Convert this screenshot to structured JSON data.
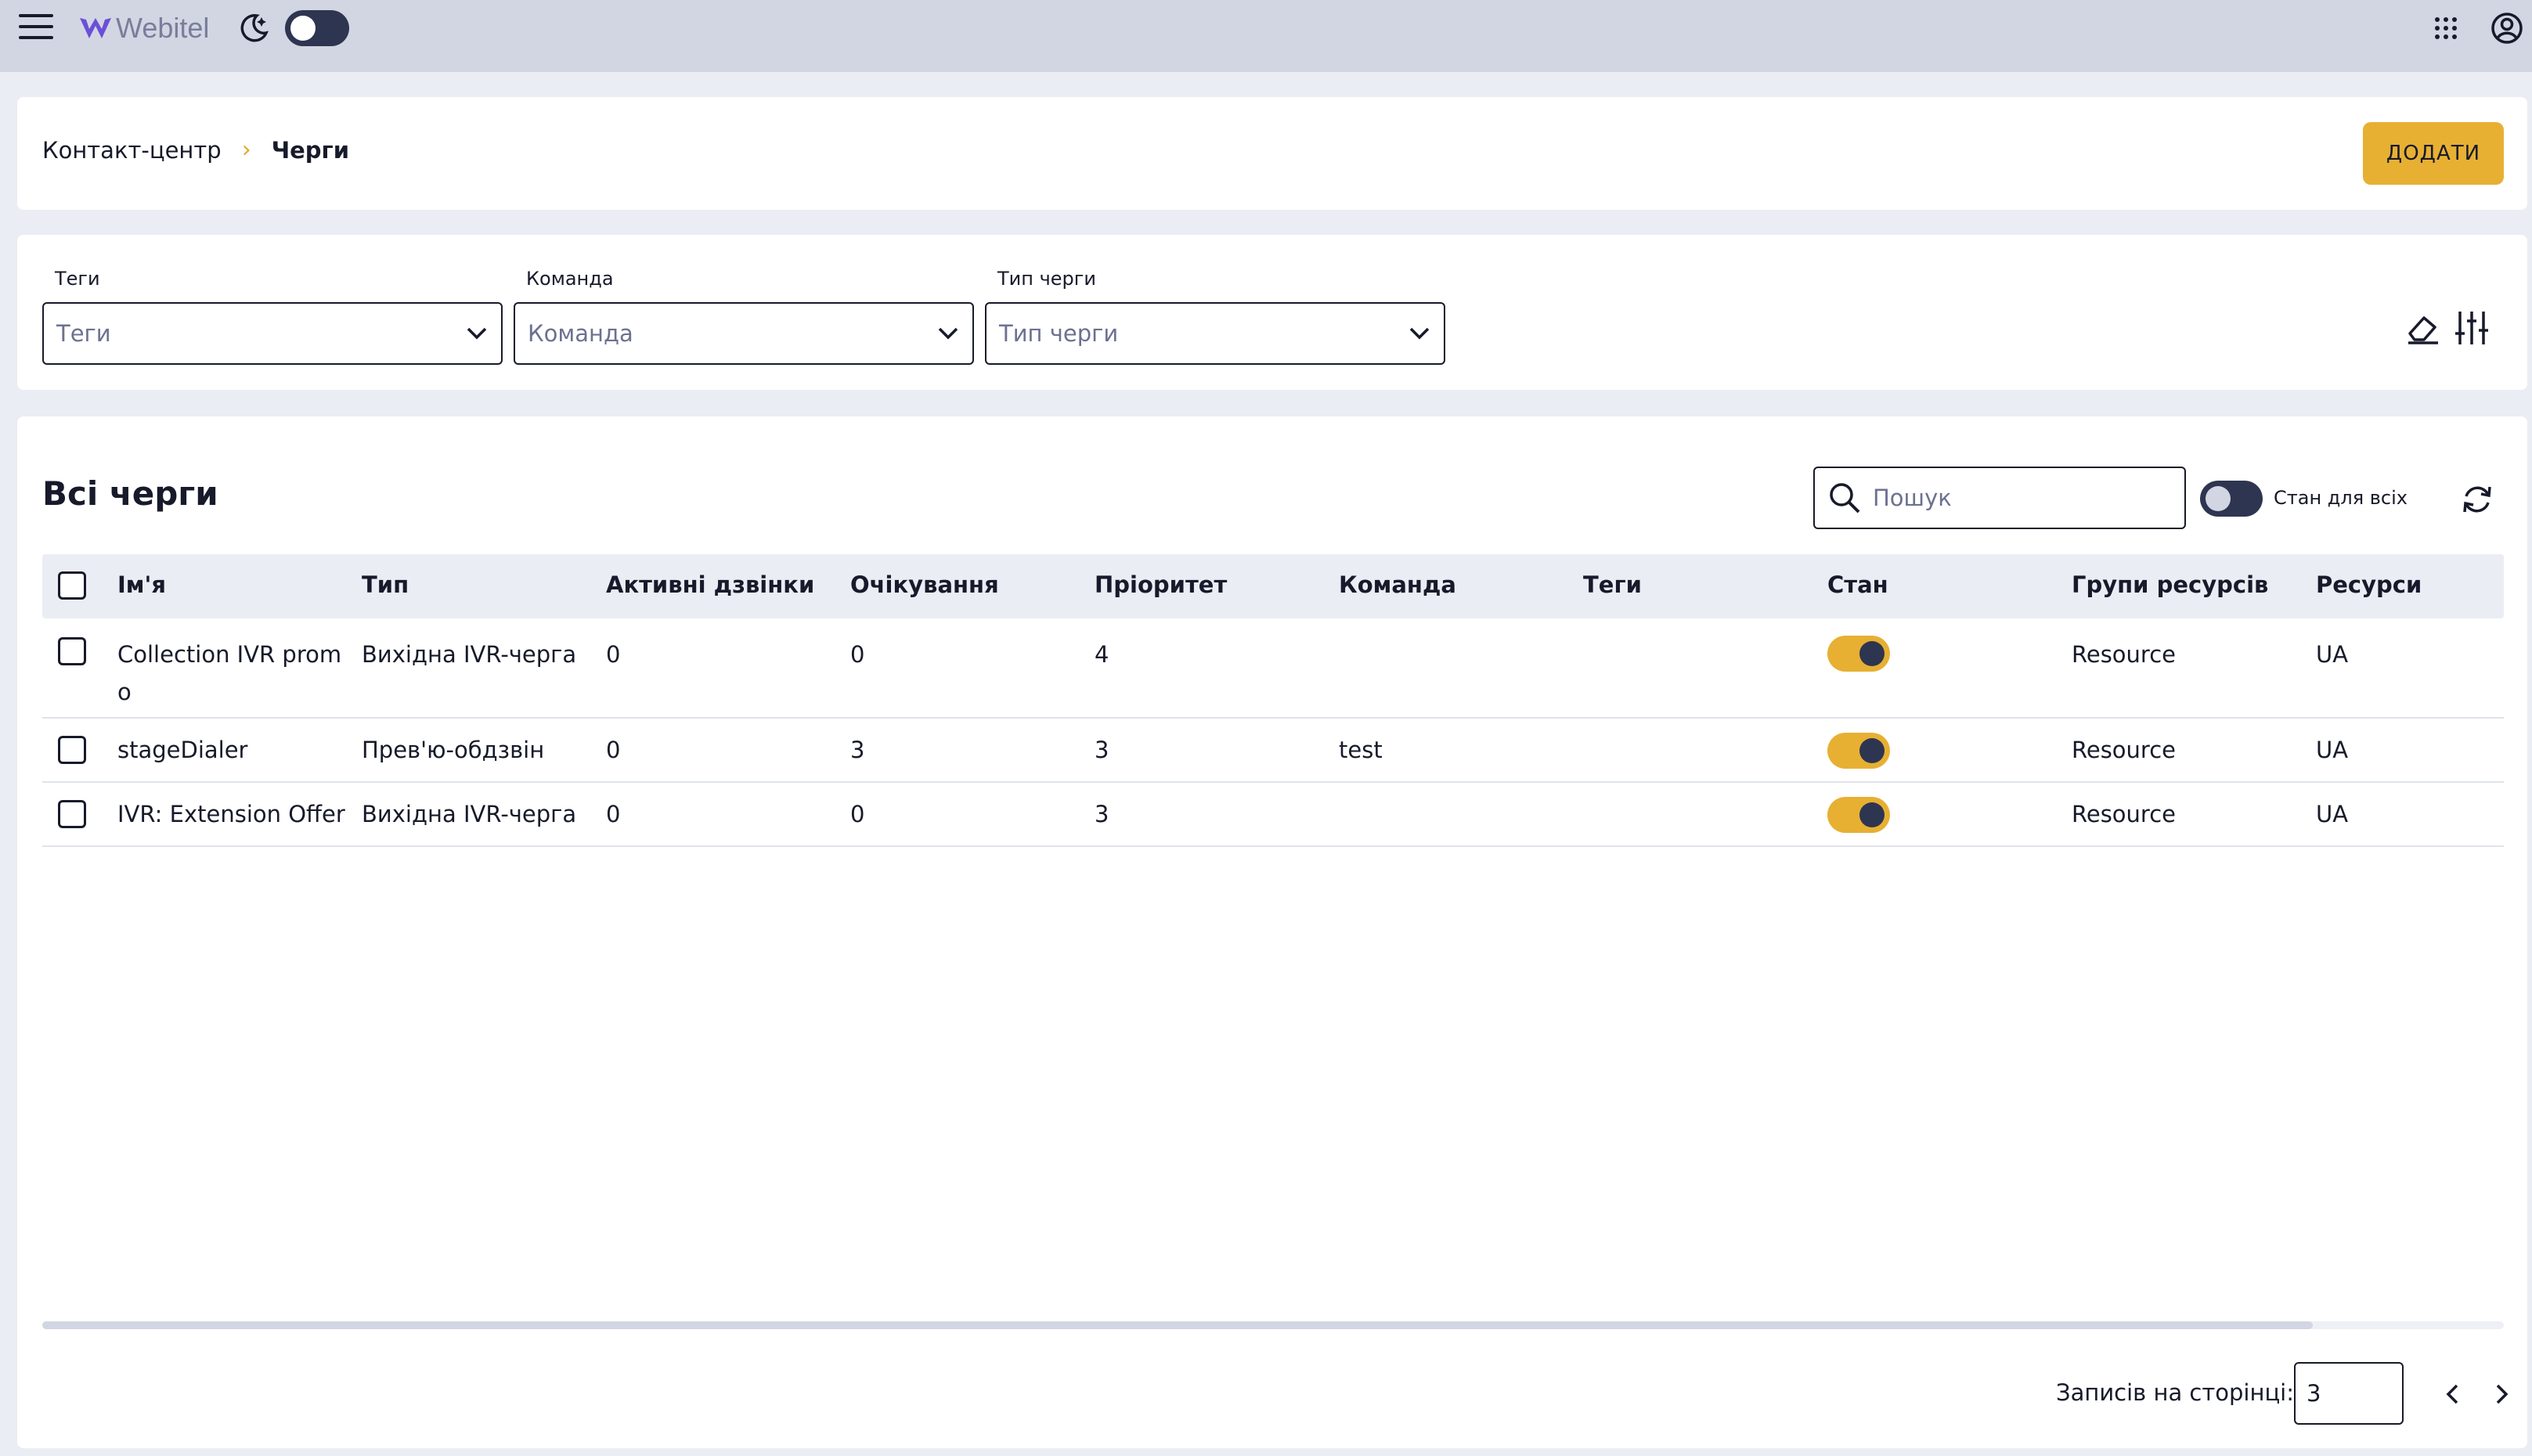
{
  "header": {
    "brand": "Webitel",
    "icons": [
      "menu-icon",
      "webitel-logo",
      "moon-icon",
      "apps-grid-icon",
      "account-icon"
    ]
  },
  "breadcrumb": {
    "parent": "Контакт-центр",
    "separator": "›",
    "current": "Черги"
  },
  "actions": {
    "add_label": "ДОДАТИ"
  },
  "filters": [
    {
      "label": "Теги",
      "placeholder": "Теги"
    },
    {
      "label": "Команда",
      "placeholder": "Команда"
    },
    {
      "label": "Тип черги",
      "placeholder": "Тип черги"
    }
  ],
  "table": {
    "title": "Всі черги",
    "search_placeholder": "Пошук",
    "state_all_label": "Стан для всіх",
    "columns": [
      "Ім'я",
      "Тип",
      "Активні дзвінки",
      "Очікування",
      "Пріоритет",
      "Команда",
      "Теги",
      "Стан",
      "Групи ресурсів",
      "Ресурси"
    ],
    "rows": [
      {
        "name": "Collection IVR promo",
        "type": "Вихідна IVR-черга",
        "active": "0",
        "waiting": "0",
        "priority": "4",
        "team": "",
        "tags": "",
        "state": true,
        "resource_groups": "Resource",
        "resources": "UA"
      },
      {
        "name": "stageDialer",
        "type": "Прев'ю-обдзвін",
        "active": "0",
        "waiting": "3",
        "priority": "3",
        "team": "test",
        "tags": "",
        "state": true,
        "resource_groups": "Resource",
        "resources": "UA"
      },
      {
        "name": "IVR: Extension Offer",
        "type": "Вихідна IVR-черга",
        "active": "0",
        "waiting": "0",
        "priority": "3",
        "team": "",
        "tags": "",
        "state": true,
        "resource_groups": "Resource",
        "resources": "UA"
      }
    ]
  },
  "pagination": {
    "label": "Записів на сторінці:",
    "size": "3"
  },
  "colors": {
    "accent": "#E7B033",
    "header_bg": "#D2D6E3",
    "dark": "#2E3550",
    "page_bg": "#EAEDF3"
  }
}
